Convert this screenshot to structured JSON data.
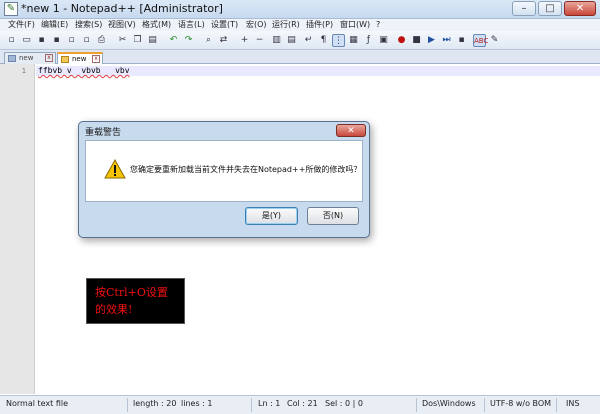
{
  "window": {
    "title": "*new  1 - Notepad++ [Administrator]",
    "minimize_glyph": "–",
    "maximize_glyph": "□",
    "close_glyph": "✕"
  },
  "menu": [
    "文件(F)",
    "编辑(E)",
    "搜索(S)",
    "视图(V)",
    "格式(M)",
    "语言(L)",
    "设置(T)",
    "宏(O)",
    "运行(R)",
    "插件(P)",
    "窗口(W)",
    "?"
  ],
  "toolbar_icons": [
    "new-file-icon",
    "open-file-icon",
    "save-icon",
    "save-all-icon",
    "close-icon",
    "close-all-icon",
    "print-icon",
    "cut-icon",
    "copy-icon",
    "paste-icon",
    "undo-icon",
    "redo-icon",
    "find-icon",
    "replace-icon",
    "zoom-in-icon",
    "zoom-out-icon",
    "sync-v-icon",
    "sync-h-icon",
    "word-wrap-icon",
    "show-all-chars-icon",
    "indent-guide-icon",
    "doc-map-icon",
    "function-list-icon",
    "folder-workspace-icon",
    "record-macro-icon",
    "stop-record-icon",
    "play-macro-icon",
    "run-macro-icon",
    "save-macro-icon",
    "spell-check-icon",
    "notes-icon"
  ],
  "tabs": [
    {
      "label": "new",
      "active": false
    },
    {
      "label": "new",
      "active": true
    }
  ],
  "editor": {
    "line_number": "1",
    "text": "ffbvb v  vbvb   vbv"
  },
  "dialog": {
    "title": "重载警告",
    "close_glyph": "✕",
    "message": "您确定要重新加载当前文件并失去在Notepad++所做的修改吗？",
    "yes_label": "是(Y)",
    "no_label": "否(N)"
  },
  "overlay": {
    "line1": "按Ctrl+O设置",
    "line2": "的效果!",
    "text_color": "#f01010"
  },
  "statusbar": {
    "file_type": "Normal text file",
    "length": "length : 20",
    "lines": "lines : 1",
    "ln": "Ln : 1",
    "col": "Col : 21",
    "sel": "Sel : 0 | 0",
    "eol": "Dos\\Windows",
    "encoding": "UTF-8 w/o BOM",
    "mode": "INS"
  }
}
